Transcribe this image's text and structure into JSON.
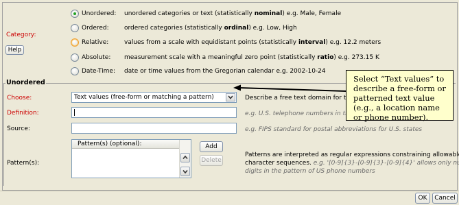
{
  "category": {
    "label": "Category:",
    "help_label": "Help",
    "options": [
      {
        "label": "Unordered:",
        "desc_pre": "unordered categories or text (statistically ",
        "desc_bold": "nominal",
        "desc_post": ") e.g. Male, Female",
        "selected": true
      },
      {
        "label": "Ordered:",
        "desc_pre": "ordered categories (statistically ",
        "desc_bold": "ordinal",
        "desc_post": ") e.g. Low, High",
        "selected": false
      },
      {
        "label": "Relative:",
        "desc_pre": "values from a scale with equidistant points (statistically ",
        "desc_bold": "interval",
        "desc_post": ") e.g. 12.2 meters",
        "selected": false
      },
      {
        "label": "Absolute:",
        "desc_pre": "measurement scale with a meaningful zero point (statistically ",
        "desc_bold": "ratio",
        "desc_post": ") e.g. 273.15 K",
        "selected": false
      },
      {
        "label": "Date-Time:",
        "desc_pre": "date or time values from the Gregorian calendar e.g. 2002-10-24",
        "desc_bold": "",
        "desc_post": "",
        "selected": false
      }
    ]
  },
  "unordered": {
    "section_title": "Unordered",
    "choose": {
      "label": "Choose:",
      "value": "Text values (free-form or matching a pattern)",
      "hint": "Describe a free text domain for the"
    },
    "definition": {
      "label": "Definition:",
      "value": "",
      "hint": "e.g. U.S. telephone numbers in the"
    },
    "source": {
      "label": "Source:",
      "value": "",
      "hint": "e.g. FIPS standard for postal abbreviations for U.S. states"
    },
    "patterns": {
      "label": "Pattern(s):",
      "header": "Pattern(s) (optional):",
      "add_label": "Add",
      "delete_label": "Delete",
      "hint_line1": "Patterns are interpreted as regular expressions constraining allowable",
      "hint_line2_pre": "character sequences. ",
      "hint_line2_ex": "e.g. '[0-9]{3}-[0-9]{3}-[0-9]{4}' allows only numeric",
      "hint_line3": "digits in the pattern of US phone numbers"
    }
  },
  "callout": {
    "text": "Select “Text values” to describe a free-form or patterned text value (e.g., a location name or phone number)."
  },
  "footer": {
    "ok_label": "OK",
    "cancel_label": "Cancel"
  }
}
